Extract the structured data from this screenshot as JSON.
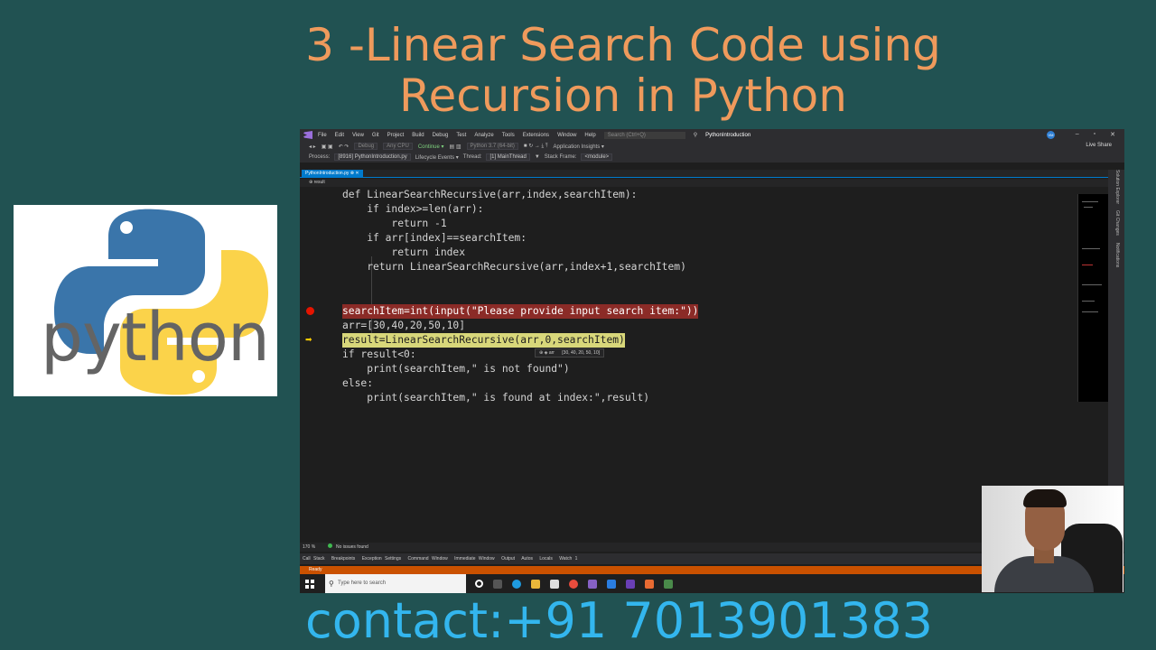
{
  "title": {
    "line1": "3 -Linear Search Code using",
    "line2": "Recursion in Python"
  },
  "contact": "contact:+91 7013901383",
  "logo": {
    "text": "python"
  },
  "ide": {
    "menu": [
      "File",
      "Edit",
      "View",
      "Git",
      "Project",
      "Build",
      "Debug",
      "Test",
      "Analyze",
      "Tools",
      "Extensions",
      "Window",
      "Help"
    ],
    "search_placeholder": "Search (Ctrl+Q)",
    "project_name": "PythonIntroduction",
    "avatar_initials": "VM",
    "toolbar": {
      "config": "Debug",
      "platform": "Any CPU",
      "continue": "Continue ▾",
      "env": "Python 3.7 (64-bit)",
      "insights": "Application Insights ▾",
      "live_share": "Live Share"
    },
    "procbar": {
      "process_label": "Process:",
      "process": "[8916] PythonIntroduction.py",
      "lifecycle": "Lifecycle Events ▾",
      "thread_label": "Thread:",
      "thread": "[1] MainThread",
      "stack_label": "Stack Frame:",
      "stack": "<module>"
    },
    "tab": "PythonIntroduction.py  ⊗ ✕",
    "nav": "⊕ result",
    "code": [
      "def LinearSearchRecursive(arr,index,searchItem):",
      "    if index>=len(arr):",
      "        return -1",
      "    if arr[index]==searchItem:",
      "        return index",
      "    return LinearSearchRecursive(arr,index+1,searchItem)",
      "",
      "",
      "searchItem=int(input(\"Please provide input search item:\"))",
      "arr=[30,40,20,50,10]",
      "result=LinearSearchRecursive(arr,0,searchItem)",
      "if result<0:",
      "    print(searchItem,\" is not found\")",
      "else:",
      "    print(searchItem,\" is found at index:\",result)"
    ],
    "datatip": {
      "name": "arr",
      "value": "[30, 40, 20, 50, 10]"
    },
    "side_tabs": [
      "Solution Explorer",
      "Git Changes",
      "Notifications"
    ],
    "zoom": "170 %",
    "issues": "No issues found",
    "tool_windows": [
      "Call Stack",
      "Breakpoints",
      "Exception Settings",
      "Command Window",
      "Immediate Window",
      "Output",
      "Autos",
      "Locals",
      "Watch 1"
    ],
    "status": "Ready",
    "taskbar_search": "Type here to search"
  }
}
